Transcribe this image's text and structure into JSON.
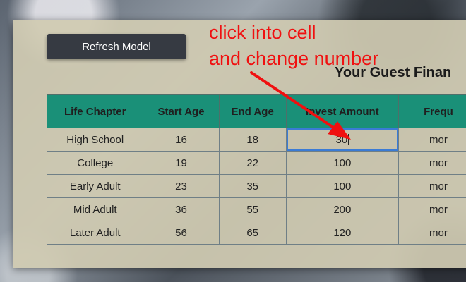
{
  "refresh_button": {
    "label": "Refresh Model"
  },
  "title": "Your Guest Finan",
  "annotation": {
    "line1": "click into cell",
    "line2": "and change number"
  },
  "table": {
    "headers": [
      "Life Chapter",
      "Start Age",
      "End Age",
      "Invest Amount",
      "Frequ"
    ],
    "rows": [
      [
        "High School",
        "16",
        "18",
        "30",
        "mor"
      ],
      [
        "College",
        "19",
        "22",
        "100",
        "mor"
      ],
      [
        "Early Adult",
        "23",
        "35",
        "100",
        "mor"
      ],
      [
        "Mid Adult",
        "36",
        "55",
        "200",
        "mor"
      ],
      [
        "Later Adult",
        "56",
        "65",
        "120",
        "mor"
      ]
    ]
  },
  "colors": {
    "header": "#1a9078",
    "annotation": "#f01010",
    "active_border": "#3a7bd5",
    "button": "#363a42"
  }
}
